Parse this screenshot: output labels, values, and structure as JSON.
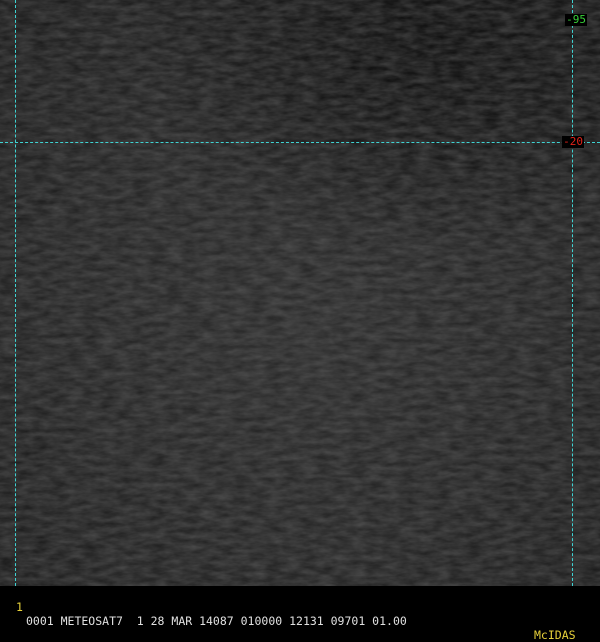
{
  "grid": {
    "color": "#3fd3d3",
    "longitude_label": "-95",
    "latitude_label": "-20",
    "longitude_label_color": "#39d139",
    "latitude_label_color": "#e2231a"
  },
  "imagery": {
    "tone": "dark grey satellite infrared texture"
  },
  "status_bar": {
    "frame_number": "1",
    "text": "0001 METEOSAT7  1 28 MAR 14087 010000 12131 09701 01.00",
    "brand": "McIDAS",
    "frame_color": "#e8d23a",
    "text_color": "#e0e0e0"
  }
}
